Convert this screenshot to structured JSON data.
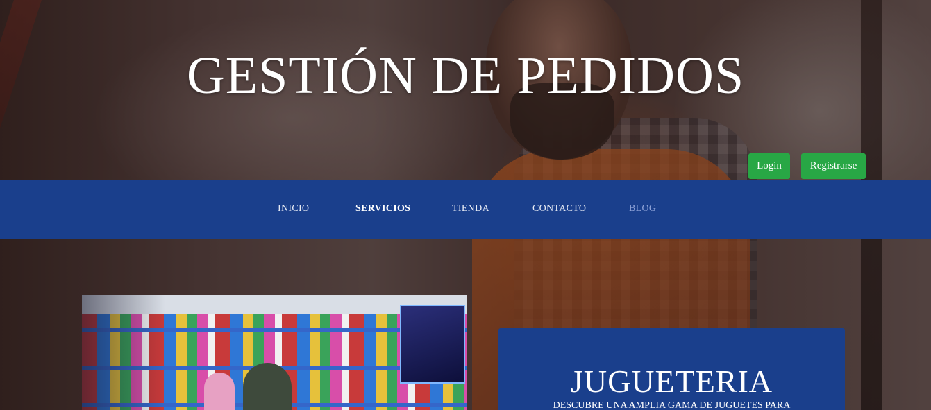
{
  "header": {
    "title": "GESTIÓN DE PEDIDOS"
  },
  "auth": {
    "login_label": "Login",
    "register_label": "Registrarse",
    "button_color": "#28a745"
  },
  "nav": {
    "background": "#1a3f8c",
    "items": [
      {
        "label": "INICIO",
        "state": "normal"
      },
      {
        "label": "SERVICIOS",
        "state": "active"
      },
      {
        "label": "TIENDA",
        "state": "normal"
      },
      {
        "label": "CONTACTO",
        "state": "normal"
      },
      {
        "label": "BLOG",
        "state": "visited"
      }
    ]
  },
  "main": {
    "card": {
      "title": "JUGUETERIA",
      "text": "DESCUBRE UNA AMPLIA GAMA DE JUGUETES PARA"
    }
  }
}
